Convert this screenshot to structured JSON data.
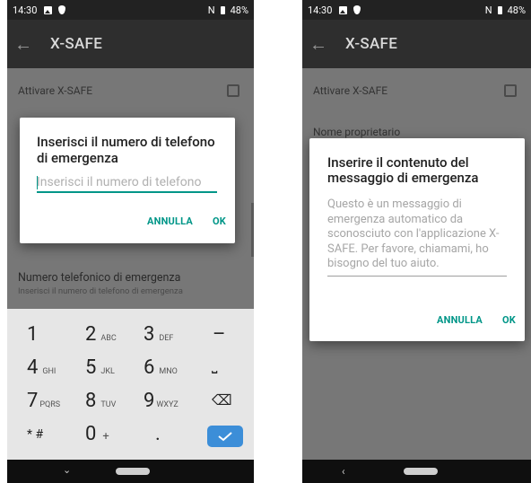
{
  "status": {
    "time": "14:30",
    "battery": "48%",
    "nfc": "N"
  },
  "left": {
    "app_title": "X-SAFE",
    "activate_label": "Attivare X-SAFE",
    "dialog": {
      "title": "Inserisci il numero di telefono di emergenza",
      "placeholder": "Inserisci il numero di telefono",
      "cancel": "ANNULLA",
      "ok": "OK"
    },
    "emergency_title": "Numero telefonico di emergenza",
    "emergency_sub": "Inserisci il numero di telefono di emergenza",
    "keyboard": {
      "keys": [
        {
          "d": "1",
          "l": ""
        },
        {
          "d": "2",
          "l": "ABC"
        },
        {
          "d": "3",
          "l": "DEF"
        },
        {
          "d": "–",
          "l": ""
        },
        {
          "d": "4",
          "l": "GHI"
        },
        {
          "d": "5",
          "l": "JKL"
        },
        {
          "d": "6",
          "l": "MNO"
        },
        {
          "d": "⎵",
          "l": ""
        },
        {
          "d": "7",
          "l": "PQRS"
        },
        {
          "d": "8",
          "l": "TUV"
        },
        {
          "d": "9",
          "l": "WXYZ"
        },
        {
          "d": "⌫",
          "l": ""
        },
        {
          "d": "* #",
          "l": ""
        },
        {
          "d": "0",
          "l": "+"
        },
        {
          "d": ".",
          "l": ""
        }
      ]
    }
  },
  "right": {
    "app_title": "X-SAFE",
    "activate_label": "Attivare X-SAFE",
    "owner_label": "Nome proprietario",
    "dialog": {
      "title": "Inserire il contenuto del messaggio di emergenza",
      "text": "Questo è un messaggio di emergenza automatico da sconosciuto con l'applicazione X-SAFE. Per favore, chiamami, ho bisogno del tuo aiuto.",
      "cancel": "ANNULLA",
      "ok": "OK"
    }
  },
  "colors": {
    "accent": "#009688",
    "done_key": "#3c8ed8"
  }
}
